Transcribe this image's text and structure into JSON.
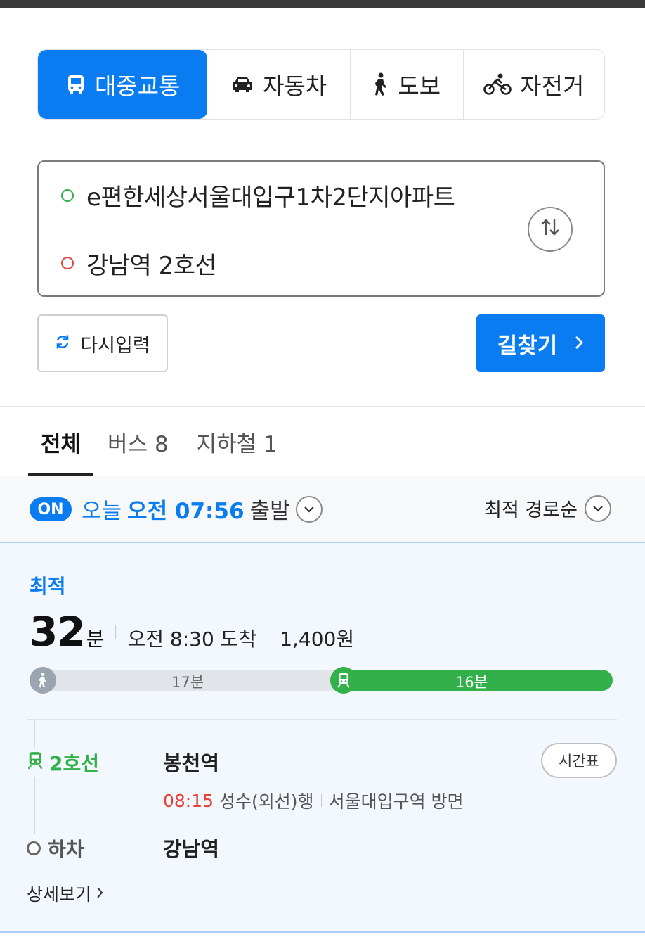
{
  "modes": [
    {
      "label": "대중교통",
      "icon": "bus-icon",
      "active": true
    },
    {
      "label": "자동차",
      "icon": "car-icon",
      "active": false
    },
    {
      "label": "도보",
      "icon": "walk-icon",
      "active": false
    },
    {
      "label": "자전거",
      "icon": "bicycle-icon",
      "active": false
    }
  ],
  "route": {
    "start": "e편한세상서울대입구1차2단지아파트",
    "end": "강남역 2호선",
    "swap_icon": "swap-icon"
  },
  "actions": {
    "reset_label": "다시입력",
    "search_label": "길찾기"
  },
  "result_tabs": [
    {
      "label": "전체",
      "active": true
    },
    {
      "label": "버스 8",
      "active": false
    },
    {
      "label": "지하철 1",
      "active": false
    }
  ],
  "filter": {
    "on_badge": "ON",
    "day": "오늘",
    "time": "오전 07:56",
    "suffix": "출발",
    "sort_label": "최적 경로순"
  },
  "route_card": {
    "badge": "최적",
    "minutes": "32",
    "minutes_unit": "분",
    "arrival": "오전 8:30 도착",
    "fare": "1,400원",
    "walk_time": "17분",
    "subway_time": "16분",
    "walk_fraction": 0.53,
    "line_name": "2호선",
    "board_station": "봉천역",
    "timetable_label": "시간표",
    "next_time": "08:15",
    "direction": "성수(외선)행",
    "towards": "서울대입구역 방면",
    "getoff_label": "하차",
    "getoff_station": "강남역",
    "detail_label": "상세보기"
  },
  "colors": {
    "primary": "#0a7cf2",
    "subway_line2": "#32b14a",
    "alert": "#e8413a"
  }
}
